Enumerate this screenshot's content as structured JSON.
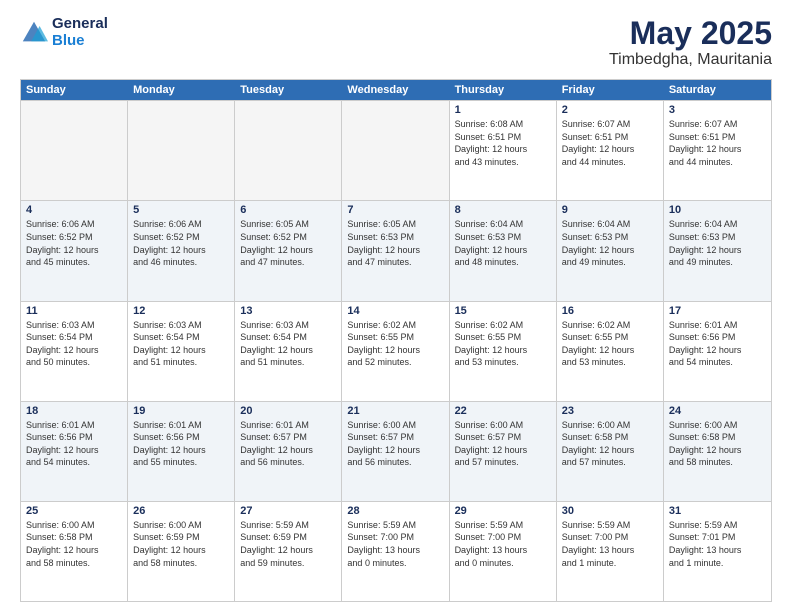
{
  "header": {
    "logo_general": "General",
    "logo_blue": "Blue",
    "month": "May 2025",
    "location": "Timbedgha, Mauritania"
  },
  "weekdays": [
    "Sunday",
    "Monday",
    "Tuesday",
    "Wednesday",
    "Thursday",
    "Friday",
    "Saturday"
  ],
  "rows": [
    [
      {
        "day": "",
        "info": "",
        "empty": true
      },
      {
        "day": "",
        "info": "",
        "empty": true
      },
      {
        "day": "",
        "info": "",
        "empty": true
      },
      {
        "day": "",
        "info": "",
        "empty": true
      },
      {
        "day": "1",
        "info": "Sunrise: 6:08 AM\nSunset: 6:51 PM\nDaylight: 12 hours\nand 43 minutes."
      },
      {
        "day": "2",
        "info": "Sunrise: 6:07 AM\nSunset: 6:51 PM\nDaylight: 12 hours\nand 44 minutes."
      },
      {
        "day": "3",
        "info": "Sunrise: 6:07 AM\nSunset: 6:51 PM\nDaylight: 12 hours\nand 44 minutes."
      }
    ],
    [
      {
        "day": "4",
        "info": "Sunrise: 6:06 AM\nSunset: 6:52 PM\nDaylight: 12 hours\nand 45 minutes."
      },
      {
        "day": "5",
        "info": "Sunrise: 6:06 AM\nSunset: 6:52 PM\nDaylight: 12 hours\nand 46 minutes."
      },
      {
        "day": "6",
        "info": "Sunrise: 6:05 AM\nSunset: 6:52 PM\nDaylight: 12 hours\nand 47 minutes."
      },
      {
        "day": "7",
        "info": "Sunrise: 6:05 AM\nSunset: 6:53 PM\nDaylight: 12 hours\nand 47 minutes."
      },
      {
        "day": "8",
        "info": "Sunrise: 6:04 AM\nSunset: 6:53 PM\nDaylight: 12 hours\nand 48 minutes."
      },
      {
        "day": "9",
        "info": "Sunrise: 6:04 AM\nSunset: 6:53 PM\nDaylight: 12 hours\nand 49 minutes."
      },
      {
        "day": "10",
        "info": "Sunrise: 6:04 AM\nSunset: 6:53 PM\nDaylight: 12 hours\nand 49 minutes."
      }
    ],
    [
      {
        "day": "11",
        "info": "Sunrise: 6:03 AM\nSunset: 6:54 PM\nDaylight: 12 hours\nand 50 minutes."
      },
      {
        "day": "12",
        "info": "Sunrise: 6:03 AM\nSunset: 6:54 PM\nDaylight: 12 hours\nand 51 minutes."
      },
      {
        "day": "13",
        "info": "Sunrise: 6:03 AM\nSunset: 6:54 PM\nDaylight: 12 hours\nand 51 minutes."
      },
      {
        "day": "14",
        "info": "Sunrise: 6:02 AM\nSunset: 6:55 PM\nDaylight: 12 hours\nand 52 minutes."
      },
      {
        "day": "15",
        "info": "Sunrise: 6:02 AM\nSunset: 6:55 PM\nDaylight: 12 hours\nand 53 minutes."
      },
      {
        "day": "16",
        "info": "Sunrise: 6:02 AM\nSunset: 6:55 PM\nDaylight: 12 hours\nand 53 minutes."
      },
      {
        "day": "17",
        "info": "Sunrise: 6:01 AM\nSunset: 6:56 PM\nDaylight: 12 hours\nand 54 minutes."
      }
    ],
    [
      {
        "day": "18",
        "info": "Sunrise: 6:01 AM\nSunset: 6:56 PM\nDaylight: 12 hours\nand 54 minutes."
      },
      {
        "day": "19",
        "info": "Sunrise: 6:01 AM\nSunset: 6:56 PM\nDaylight: 12 hours\nand 55 minutes."
      },
      {
        "day": "20",
        "info": "Sunrise: 6:01 AM\nSunset: 6:57 PM\nDaylight: 12 hours\nand 56 minutes."
      },
      {
        "day": "21",
        "info": "Sunrise: 6:00 AM\nSunset: 6:57 PM\nDaylight: 12 hours\nand 56 minutes."
      },
      {
        "day": "22",
        "info": "Sunrise: 6:00 AM\nSunset: 6:57 PM\nDaylight: 12 hours\nand 57 minutes."
      },
      {
        "day": "23",
        "info": "Sunrise: 6:00 AM\nSunset: 6:58 PM\nDaylight: 12 hours\nand 57 minutes."
      },
      {
        "day": "24",
        "info": "Sunrise: 6:00 AM\nSunset: 6:58 PM\nDaylight: 12 hours\nand 58 minutes."
      }
    ],
    [
      {
        "day": "25",
        "info": "Sunrise: 6:00 AM\nSunset: 6:58 PM\nDaylight: 12 hours\nand 58 minutes."
      },
      {
        "day": "26",
        "info": "Sunrise: 6:00 AM\nSunset: 6:59 PM\nDaylight: 12 hours\nand 58 minutes."
      },
      {
        "day": "27",
        "info": "Sunrise: 5:59 AM\nSunset: 6:59 PM\nDaylight: 12 hours\nand 59 minutes."
      },
      {
        "day": "28",
        "info": "Sunrise: 5:59 AM\nSunset: 7:00 PM\nDaylight: 13 hours\nand 0 minutes."
      },
      {
        "day": "29",
        "info": "Sunrise: 5:59 AM\nSunset: 7:00 PM\nDaylight: 13 hours\nand 0 minutes."
      },
      {
        "day": "30",
        "info": "Sunrise: 5:59 AM\nSunset: 7:00 PM\nDaylight: 13 hours\nand 1 minute."
      },
      {
        "day": "31",
        "info": "Sunrise: 5:59 AM\nSunset: 7:01 PM\nDaylight: 13 hours\nand 1 minute."
      }
    ]
  ]
}
